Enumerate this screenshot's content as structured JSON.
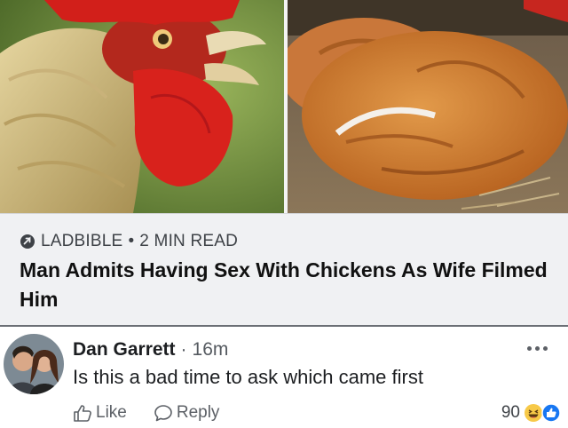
{
  "images": {
    "left_alt": "rooster-close-up",
    "right_alt": "brown-hens"
  },
  "article": {
    "source": "LADBIBLE",
    "separator": "•",
    "read_time": "2 MIN READ",
    "headline": "Man Admits Having Sex With Chickens As Wife Filmed Him"
  },
  "comment": {
    "author": "Dan Garrett",
    "dot": "·",
    "time": "16m",
    "text": "Is this a bad time to ask which came first",
    "actions": {
      "like": "Like",
      "reply": "Reply"
    },
    "reaction_count": "90",
    "reactions": [
      "haha-icon",
      "like-icon"
    ]
  },
  "colors": {
    "article_bg": "#f0f1f3",
    "haha": "#f7c948",
    "like": "#1877f2"
  }
}
